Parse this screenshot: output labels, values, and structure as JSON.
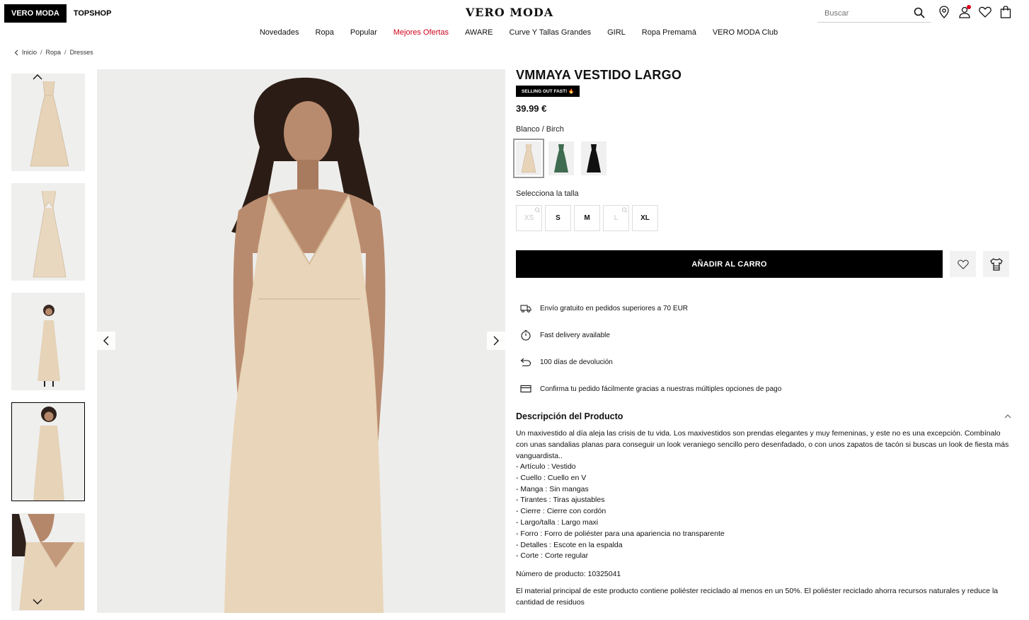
{
  "header": {
    "brand_tabs": [
      "VERO MODA",
      "TOPSHOP"
    ],
    "logo": "VERO MODA",
    "search_placeholder": "Buscar"
  },
  "nav": {
    "items": [
      "Novedades",
      "Ropa",
      "Popular",
      "Mejores Ofertas",
      "AWARE",
      "Curve Y Tallas Grandes",
      "GIRL",
      "Ropa Premamá",
      "VERO MODA Club"
    ]
  },
  "breadcrumb": [
    "Inicio",
    "Ropa",
    "Dresses"
  ],
  "product": {
    "title": "VMMAYA VESTIDO LARGO",
    "badge": "SELLING OUT FAST! 🔥",
    "price": "39.99 €",
    "color_name": "Blanco / Birch",
    "size_label": "Selecciona la talla",
    "sizes": [
      "XS",
      "S",
      "M",
      "L",
      "XL"
    ],
    "add_to_cart": "AÑADIR AL CARRO"
  },
  "benefits": [
    "Envío gratuito en pedidos superiores a 70 EUR",
    "Fast delivery available",
    "100 días de devolución",
    "Confirma tu pedido fácilmente gracias a nuestras múltiples opciones de pago"
  ],
  "description": {
    "heading": "Descripción del Producto",
    "intro": "Un maxivestido al día aleja las crisis de tu vida. Los maxivestidos son prendas elegantes y muy femeninas, y este no es una excepción. Combínalo con unas sandalias planas para conseguir un look veraniego sencillo pero desenfadado, o con unos zapatos de tacón si buscas un look de fiesta más vanguardista..",
    "specs": [
      "- Artículo : Vestido",
      "- Cuello : Cuello en V",
      "- Manga : Sin mangas",
      "- Tirantes : Tiras ajustables",
      "- Cierre : Cierre con cordón",
      "- Largo/talla : Largo maxi",
      "- Forro : Forro de poliéster para una apariencia no transparente",
      "- Detalles : Escote en la espalda",
      "- Corte : Corte regular"
    ],
    "product_number": "Número de producto: 10325041",
    "material": "El material principal de este producto contiene poliéster reciclado al menos en un 50%. El poliéster reciclado ahorra recursos naturales y reduce la cantidad de residuos"
  }
}
